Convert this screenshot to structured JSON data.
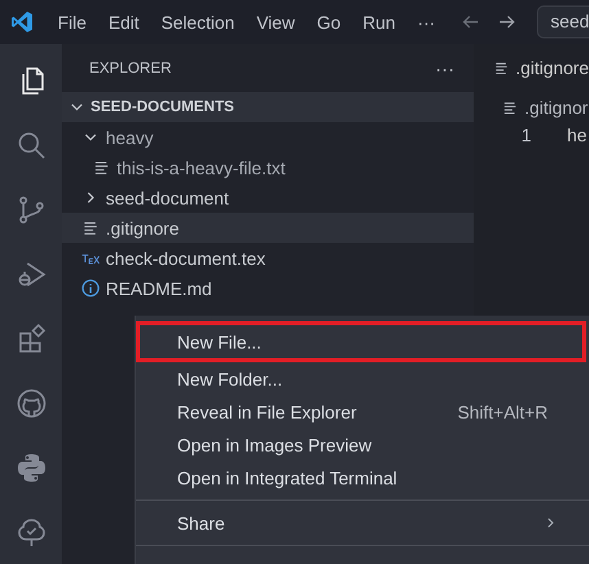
{
  "title_bar": {
    "menus": [
      "File",
      "Edit",
      "Selection",
      "View",
      "Go",
      "Run"
    ],
    "more": "···",
    "search": {
      "value": "seed"
    }
  },
  "activity_bar": {
    "items": [
      {
        "kind": "files",
        "selected": true
      },
      {
        "kind": "search",
        "selected": false
      },
      {
        "kind": "source-control",
        "selected": false
      },
      {
        "kind": "run-debug",
        "selected": false
      },
      {
        "kind": "extensions",
        "selected": false
      },
      {
        "kind": "github",
        "selected": false
      },
      {
        "kind": "python",
        "selected": false
      },
      {
        "kind": "tree-check",
        "selected": false
      }
    ]
  },
  "sidebar": {
    "title": "EXPLORER",
    "more": "···",
    "root": {
      "label": "SEED-DOCUMENTS",
      "expanded": true,
      "children": [
        {
          "label": "heavy",
          "kind": "folder",
          "expanded": true,
          "selected": false,
          "children": [
            {
              "label": "this-is-a-heavy-file.txt",
              "kind": "text",
              "selected": false
            }
          ]
        },
        {
          "label": "seed-document",
          "kind": "folder",
          "expanded": false,
          "selected": false
        },
        {
          "label": ".gitignore",
          "kind": "text",
          "selected": true
        },
        {
          "label": "check-document.tex",
          "kind": "tex",
          "selected": false
        },
        {
          "label": "README.md",
          "kind": "info",
          "selected": false
        }
      ]
    }
  },
  "editor": {
    "tab": ".gitignore",
    "breadcrumb": ".gitignor",
    "lines": [
      {
        "number": "1",
        "text": "he"
      }
    ]
  },
  "context_menu": {
    "groups": [
      [
        {
          "label": "New File...",
          "highlighted": true
        },
        {
          "label": "New Folder...",
          "highlighted": false
        },
        {
          "label": "Reveal in File Explorer",
          "shortcut": "Shift+Alt+R",
          "highlighted": false
        },
        {
          "label": "Open in Images Preview",
          "highlighted": false
        },
        {
          "label": "Open in Integrated Terminal",
          "highlighted": false
        }
      ],
      [
        {
          "label": "Share",
          "submenu": true,
          "highlighted": false
        }
      ]
    ]
  }
}
